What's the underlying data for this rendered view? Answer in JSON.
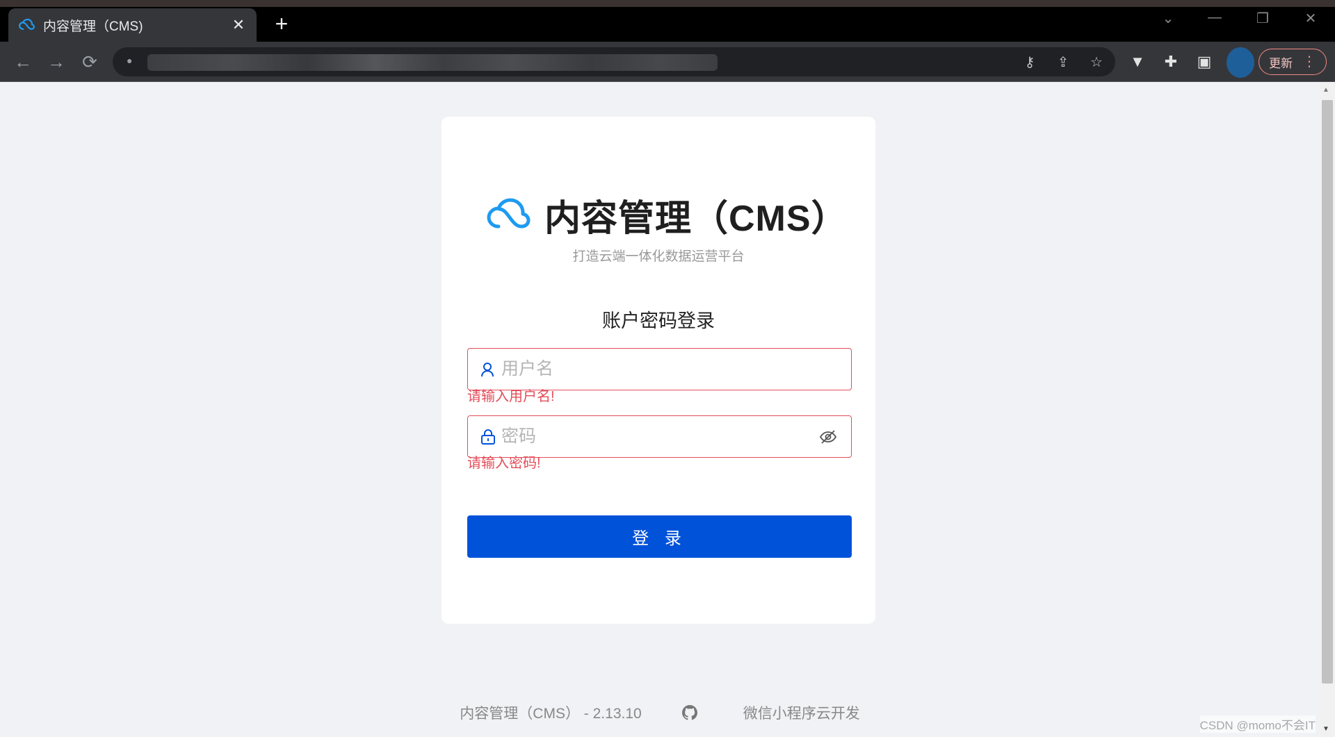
{
  "browser": {
    "tab_title": "内容管理（CMS)",
    "tab_close": "✕",
    "new_tab": "+",
    "update_label": "更新",
    "window_controls": {
      "minimize": "—",
      "restore": "❐",
      "close": "✕",
      "tabsearch": "⌄"
    }
  },
  "card": {
    "title": "内容管理（CMS）",
    "slogan": "打造云端一体化数据运营平台",
    "form_title": "账户密码登录",
    "username_placeholder": "用户名",
    "username_error": "请输入用户名!",
    "password_placeholder": "密码",
    "password_error": "请输入密码!",
    "login_label": "登 录"
  },
  "footer": {
    "version_text": "内容管理（CMS） - 2.13.10",
    "link_text": "微信小程序云开发"
  },
  "watermark": "CSDN @momo不会IT",
  "colors": {
    "accent": "#0052d9",
    "error": "#e34d59",
    "logo": "#1e9bf0",
    "page_bg": "#f0f2f5"
  },
  "icons": [
    "cloud-logo-icon",
    "user-icon",
    "lock-icon",
    "eye-off-icon",
    "github-icon",
    "back-icon",
    "forward-icon",
    "reload-icon",
    "key-icon",
    "share-icon",
    "star-icon",
    "extension-icon",
    "puzzle-icon",
    "sidepanel-icon"
  ]
}
